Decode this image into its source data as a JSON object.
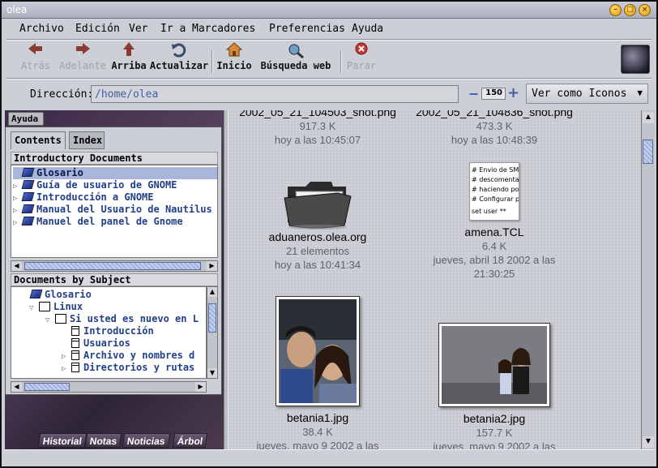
{
  "window": {
    "title": "olea"
  },
  "menubar": {
    "items": [
      "Archivo",
      "Edición",
      "Ver",
      "Ir a",
      "Marcadores",
      "Preferencias",
      "Ayuda"
    ]
  },
  "toolbar": {
    "back": "Atrás",
    "forward": "Adelante",
    "up": "Arriba",
    "reload": "Actualizar",
    "home": "Inicio",
    "search": "Búsqueda web",
    "stop": "Parar"
  },
  "location": {
    "label": "Dirección:",
    "path": "/home/olea",
    "zoom": "150",
    "view_as": "Ver como Iconos"
  },
  "sidebar": {
    "panel_title": "Ayuda",
    "tabs": [
      "Contents",
      "Index"
    ],
    "intro_header": "Introductory Documents",
    "intro_items": [
      "Glosario",
      "Guía de usuario de GNOME",
      "Introducción a GNOME",
      "Manual del Usuario de Nautilus",
      "Manuel del panel de Gnome"
    ],
    "subject_header": "Documents by Subject",
    "subject_items": [
      "Glosario",
      "Linux",
      "Si usted es nuevo en L",
      "Introducción",
      "Usuarios",
      "Archivo y nombres d",
      "Directorios y rutas"
    ],
    "bottom_tabs": [
      "Historial",
      "Notas",
      "Noticias",
      "Árbol"
    ]
  },
  "files": [
    {
      "name": "2002_05_21_104503_shot.png",
      "info": "917.3 K",
      "date": "hoy a las 10:45:07"
    },
    {
      "name": "2002_05_21_104836_shot.png",
      "info": "473.3 K",
      "date": "hoy a las 10:48:39"
    },
    {
      "name": "aduaneros.olea.org",
      "info": "21 elementos",
      "date": "hoy a las 10:41:34"
    },
    {
      "name": "amena.TCL",
      "info": "6.4 K",
      "date": "jueves, abril 18 2002 a las",
      "date2": "21:30:25"
    },
    {
      "name": "betania1.jpg",
      "info": "38.4 K",
      "date": "jueves, mayo 9 2002 a las"
    },
    {
      "name": "betania2.jpg",
      "info": "157.7 K",
      "date": "jueves, mayo 9 2002 a las"
    }
  ],
  "tcl_preview": [
    "# Envio de SM",
    "# descomenta",
    "# haciendo po",
    "# Configurar p",
    "set user **"
  ]
}
